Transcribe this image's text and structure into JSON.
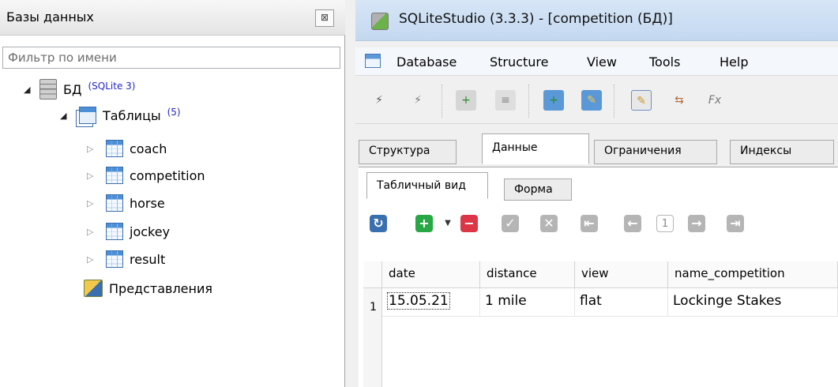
{
  "db_panel": {
    "title": "Базы данных",
    "close_glyph": "⊠",
    "filter_placeholder": "Фильтр по имени",
    "db": {
      "name": "БД",
      "type": "(SQLite 3)"
    },
    "tables_node": {
      "label": "Таблицы",
      "count": "(5)"
    },
    "tables": [
      "coach",
      "competition",
      "horse",
      "jockey",
      "result"
    ],
    "views_node": {
      "label": "Представления"
    }
  },
  "window": {
    "title": "SQLiteStudio (3.3.3) - [competition (БД)]",
    "menu": [
      "Database",
      "Structure",
      "View",
      "Tools",
      "Help"
    ],
    "fx_label": "Fx"
  },
  "editor": {
    "tabs": [
      "Структура",
      "Данные",
      "Ограничения",
      "Индексы"
    ],
    "active_tab": "Данные",
    "subtabs": [
      "Табличный вид",
      "Форма"
    ],
    "active_subtab": "Табличный вид",
    "page_number": "1",
    "grid": {
      "columns": [
        "date",
        "distance",
        "view",
        "name_competition"
      ],
      "rows": [
        {
          "row_number": "1",
          "cells": [
            "15.05.21",
            "1 mile",
            "flat",
            "Lockinge Stakes"
          ]
        }
      ]
    }
  },
  "colors": {
    "accent_blue": "#3a6fb0",
    "add_green": "#28a745",
    "delete_red": "#dc3545",
    "disabled_gray": "#b5b5b5"
  }
}
